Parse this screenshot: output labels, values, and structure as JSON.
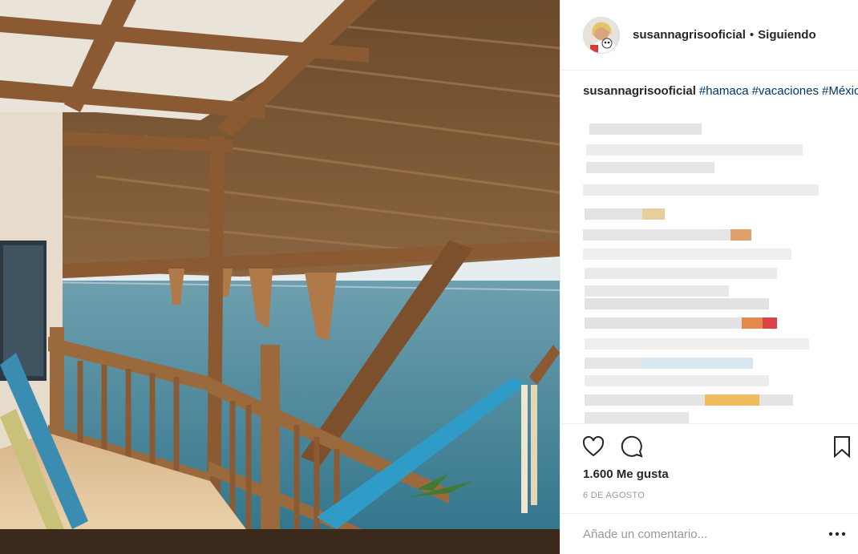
{
  "post": {
    "author": "susannagrisooficial",
    "separator": "•",
    "follow_status": "Siguiendo",
    "caption_author": "susannagrisooficial",
    "hashtags": [
      "#hamaca",
      "#vacaciones",
      "#México"
    ],
    "likes_text": "1.600 Me gusta",
    "date_text": "6 DE AGOSTO",
    "comment_placeholder": "Añade un comentario..."
  },
  "icons": {
    "like": "heart-icon",
    "comment": "speech-bubble-icon",
    "save": "bookmark-icon",
    "more": "ellipsis-icon"
  },
  "colors": {
    "hashtag": "#003569",
    "muted": "#999999",
    "text": "#262626",
    "border": "#efefef"
  }
}
